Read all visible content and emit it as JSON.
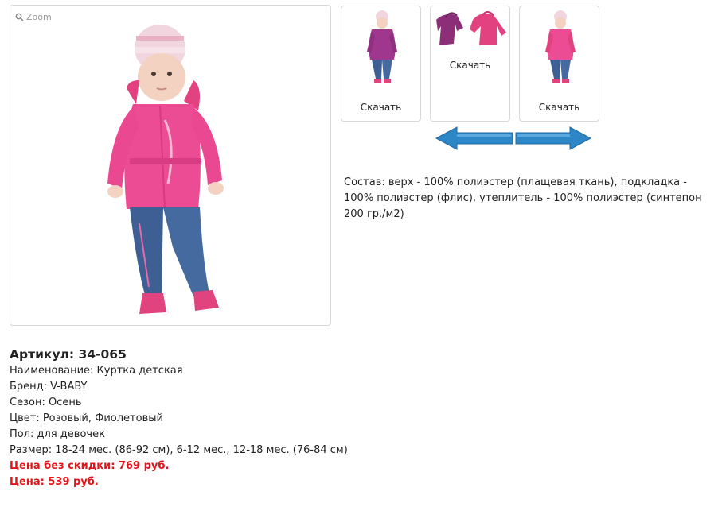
{
  "gallery": {
    "zoom_label": "Zoom",
    "main_image_icon": "child-in-pink-jacket-photo",
    "thumbnails": [
      {
        "icon": "child-purple-jacket-photo",
        "label": "Скачать"
      },
      {
        "icon": "two-jackets-photo",
        "label": "Скачать"
      },
      {
        "icon": "child-pink-jacket-photo",
        "label": "Скачать"
      }
    ],
    "arrows_icon": "left-right-arrows-icon",
    "arrow_color": "#2d86c6"
  },
  "composition": "Состав: верх - 100% полиэстер (плащевая ткань), подкладка - 100% полиэстер (флис), утеплитель - 100% полиэстер (синтепон 200 гр./м2)",
  "product": {
    "sku": "Артикул: 34-065",
    "name": "Наименование: Куртка детская",
    "brand": "Бренд: V-BABY",
    "season": "Сезон: Осень",
    "color": "Цвет: Розовый, Фиолетовый",
    "gender": "Пол: для девочек",
    "size": "Размер: 18-24 мес. (86-92 см), 6-12 мес., 12-18 мес. (76-84 см)",
    "price_no_discount": "Цена без скидки: 769 руб.",
    "price": "Цена: 539 руб."
  },
  "colors": {
    "price_red": "#e3141a",
    "jacket_pink": "#ec4c93",
    "jacket_purple": "#a0378f",
    "jeans": "#3d5f93"
  }
}
